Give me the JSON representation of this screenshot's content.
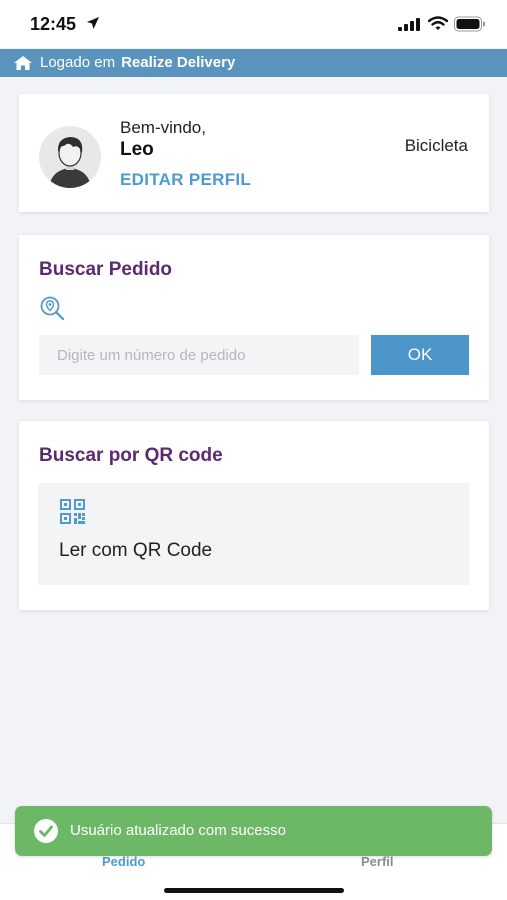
{
  "status_bar": {
    "time": "12:45",
    "icons": [
      "location-arrow-icon",
      "signal-icon",
      "wifi-icon",
      "battery-icon"
    ]
  },
  "banner": {
    "prefix": "Logado em",
    "company": "Realize Delivery",
    "icon": "home-icon",
    "color": "#5b93bf"
  },
  "profile": {
    "greeting": "Bem-vindo,",
    "name": "Leo",
    "edit_label": "EDITAR PERFIL",
    "vehicle": "Bicicleta",
    "avatar_icon": "avatar-icon"
  },
  "search": {
    "title": "Buscar Pedido",
    "icon": "map-pin-search-icon",
    "input_value": "",
    "placeholder": "Digite um número de pedido",
    "ok_label": "OK"
  },
  "qr": {
    "title": "Buscar por QR code",
    "icon": "qr-code-icon",
    "read_label": "Ler com QR Code"
  },
  "toast": {
    "icon": "check-circle-icon",
    "message": "Usuário atualizado com sucesso",
    "color": "#6cb867"
  },
  "tabs": [
    {
      "label": "Pedido",
      "active": true
    },
    {
      "label": "Perfil",
      "active": false
    }
  ],
  "colors": {
    "accent": "#4d9bd0",
    "title_purple": "#5c2a6f",
    "ok_button": "#4c95c8"
  }
}
